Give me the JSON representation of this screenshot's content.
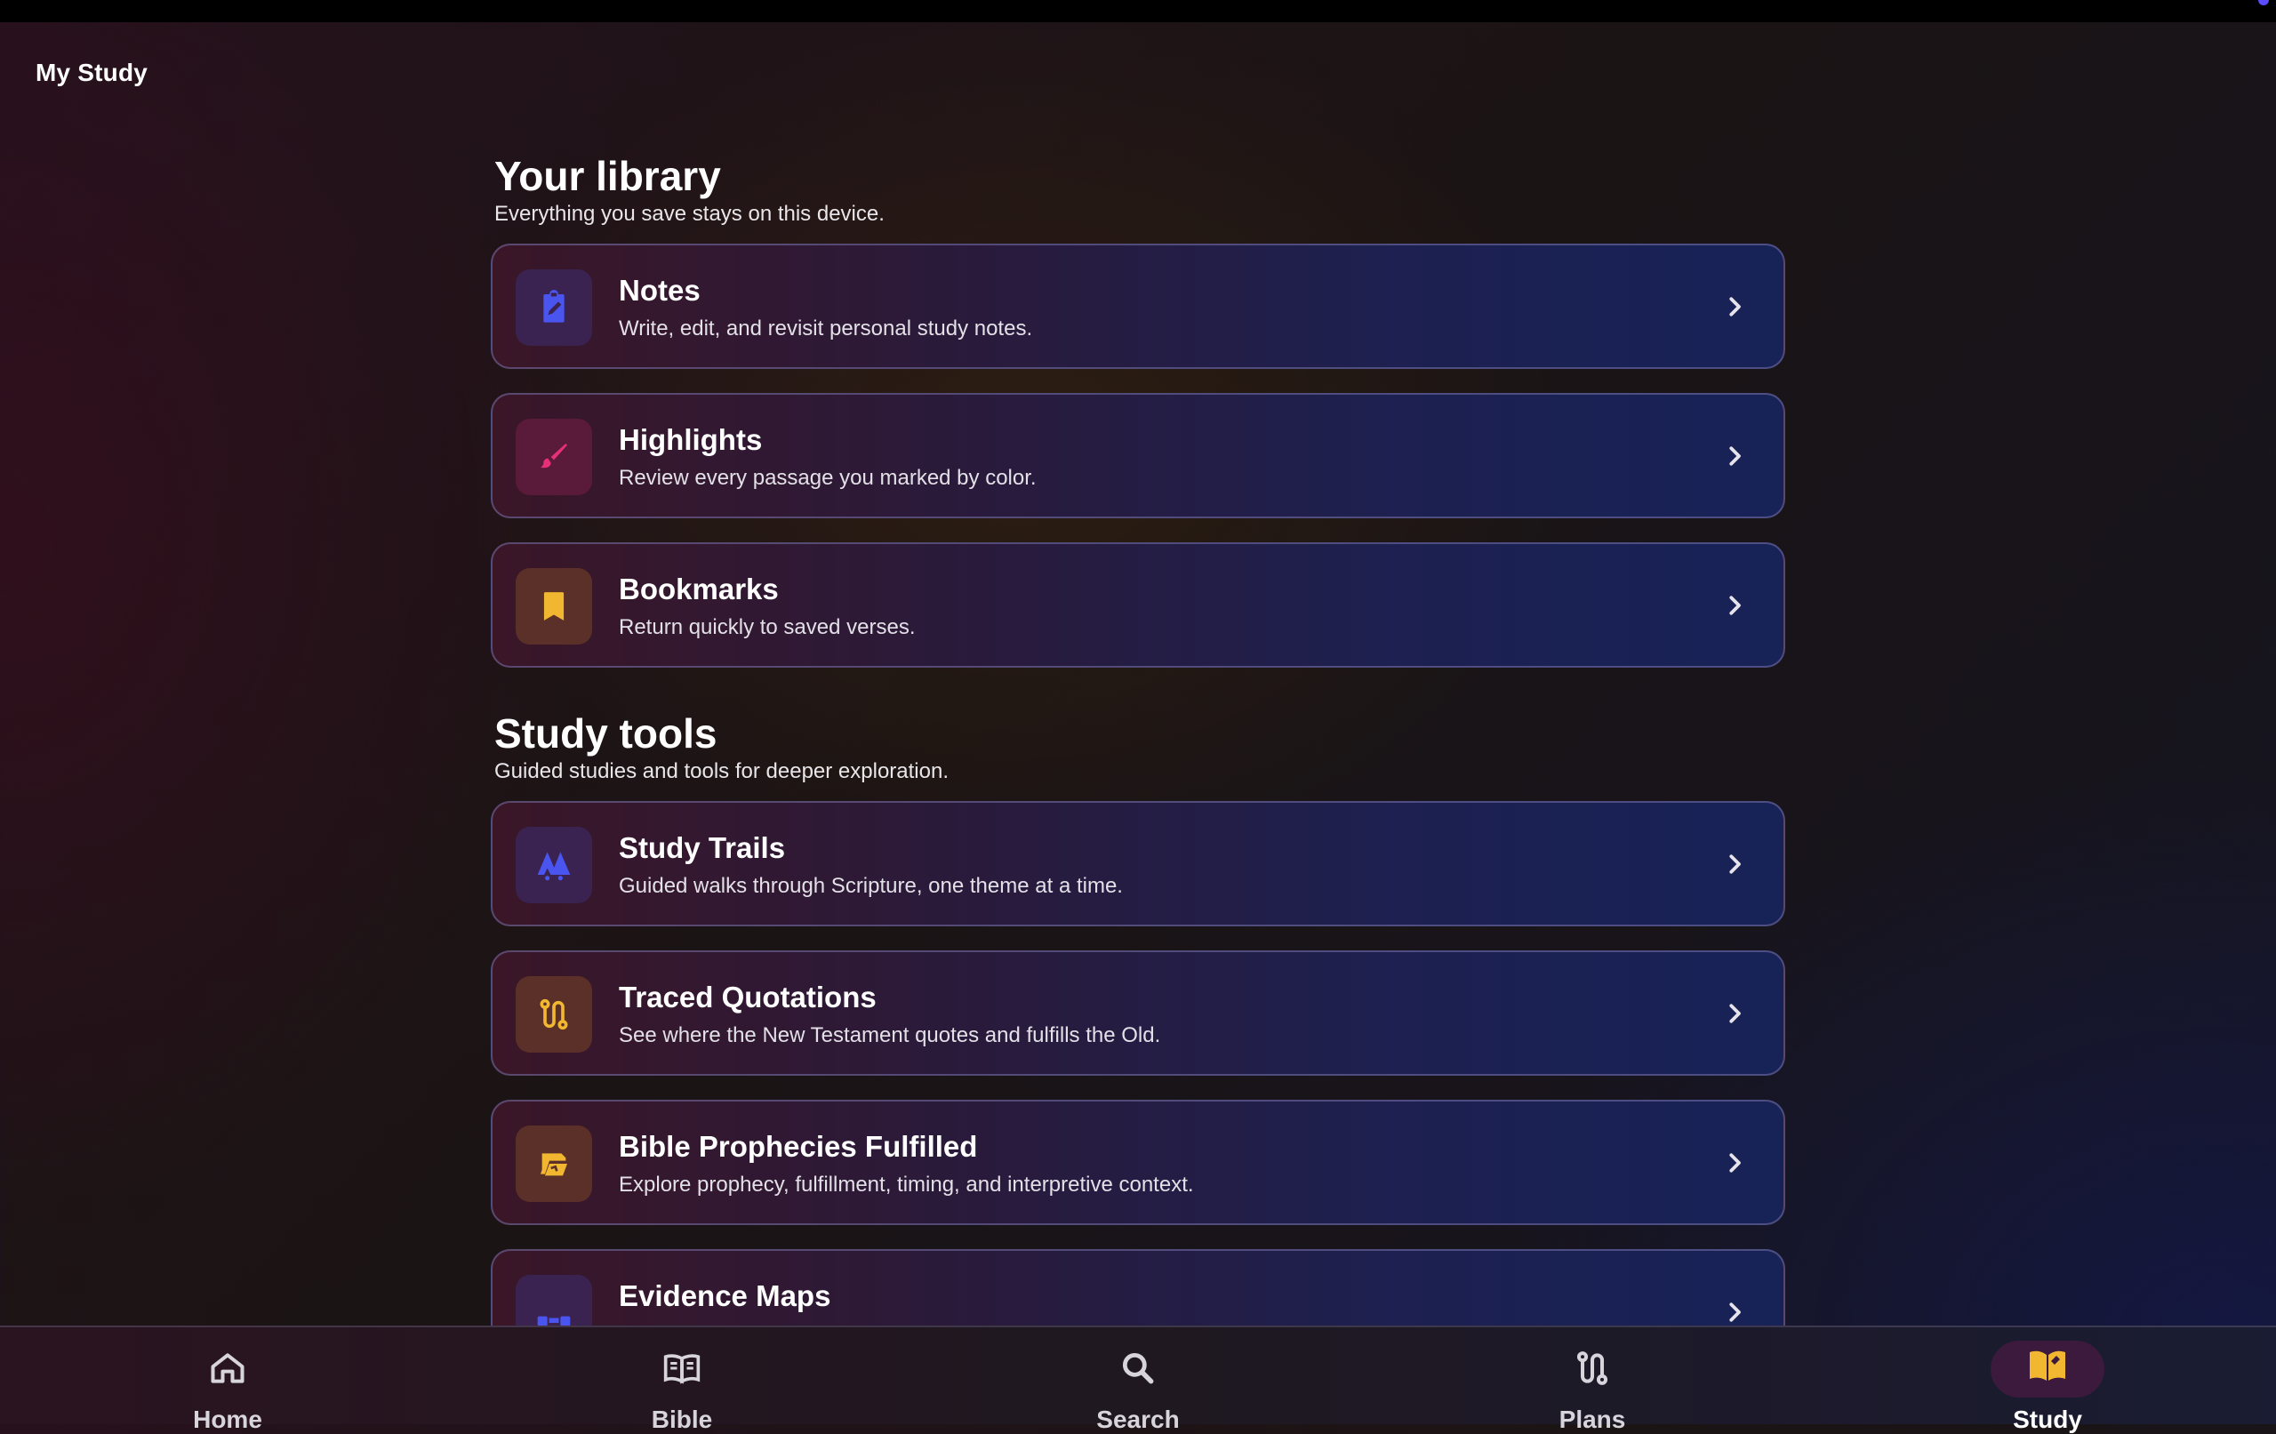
{
  "app": {
    "title": "My Study"
  },
  "library": {
    "title": "Your library",
    "subtitle": "Everything you save stays on this device.",
    "items": [
      {
        "title": "Notes",
        "subtitle": "Write, edit, and revisit personal study notes.",
        "icon": "clipboard-edit-icon",
        "color": "#4a55f0"
      },
      {
        "title": "Highlights",
        "subtitle": "Review every passage you marked by color.",
        "icon": "brush-icon",
        "color": "#e6307a"
      },
      {
        "title": "Bookmarks",
        "subtitle": "Return quickly to saved verses.",
        "icon": "bookmark-icon",
        "color": "#f2b730"
      }
    ]
  },
  "tools": {
    "title": "Study tools",
    "subtitle": "Guided studies and tools for deeper exploration.",
    "items": [
      {
        "title": "Study Trails",
        "subtitle": "Guided walks through Scripture, one theme at a time.",
        "icon": "trail-icon",
        "color": "#4a55f0"
      },
      {
        "title": "Traced Quotations",
        "subtitle": "See where the New Testament quotes and fulfills the Old.",
        "icon": "route-icon",
        "color": "#f2b730"
      },
      {
        "title": "Bible Prophecies Fulfilled",
        "subtitle": "Explore prophecy, fulfillment, timing, and interpretive context.",
        "icon": "scroll-icon",
        "color": "#f2b730"
      },
      {
        "title": "Evidence Maps",
        "subtitle": "",
        "icon": "map-icon",
        "color": "#4a55f0"
      }
    ]
  },
  "nav": {
    "items": [
      {
        "label": "Home",
        "icon": "home-icon"
      },
      {
        "label": "Bible",
        "icon": "book-icon"
      },
      {
        "label": "Search",
        "icon": "search-icon"
      },
      {
        "label": "Plans",
        "icon": "route-icon"
      },
      {
        "label": "Study",
        "icon": "open-book-icon",
        "active": true
      }
    ],
    "active_color": "#f2b730"
  }
}
